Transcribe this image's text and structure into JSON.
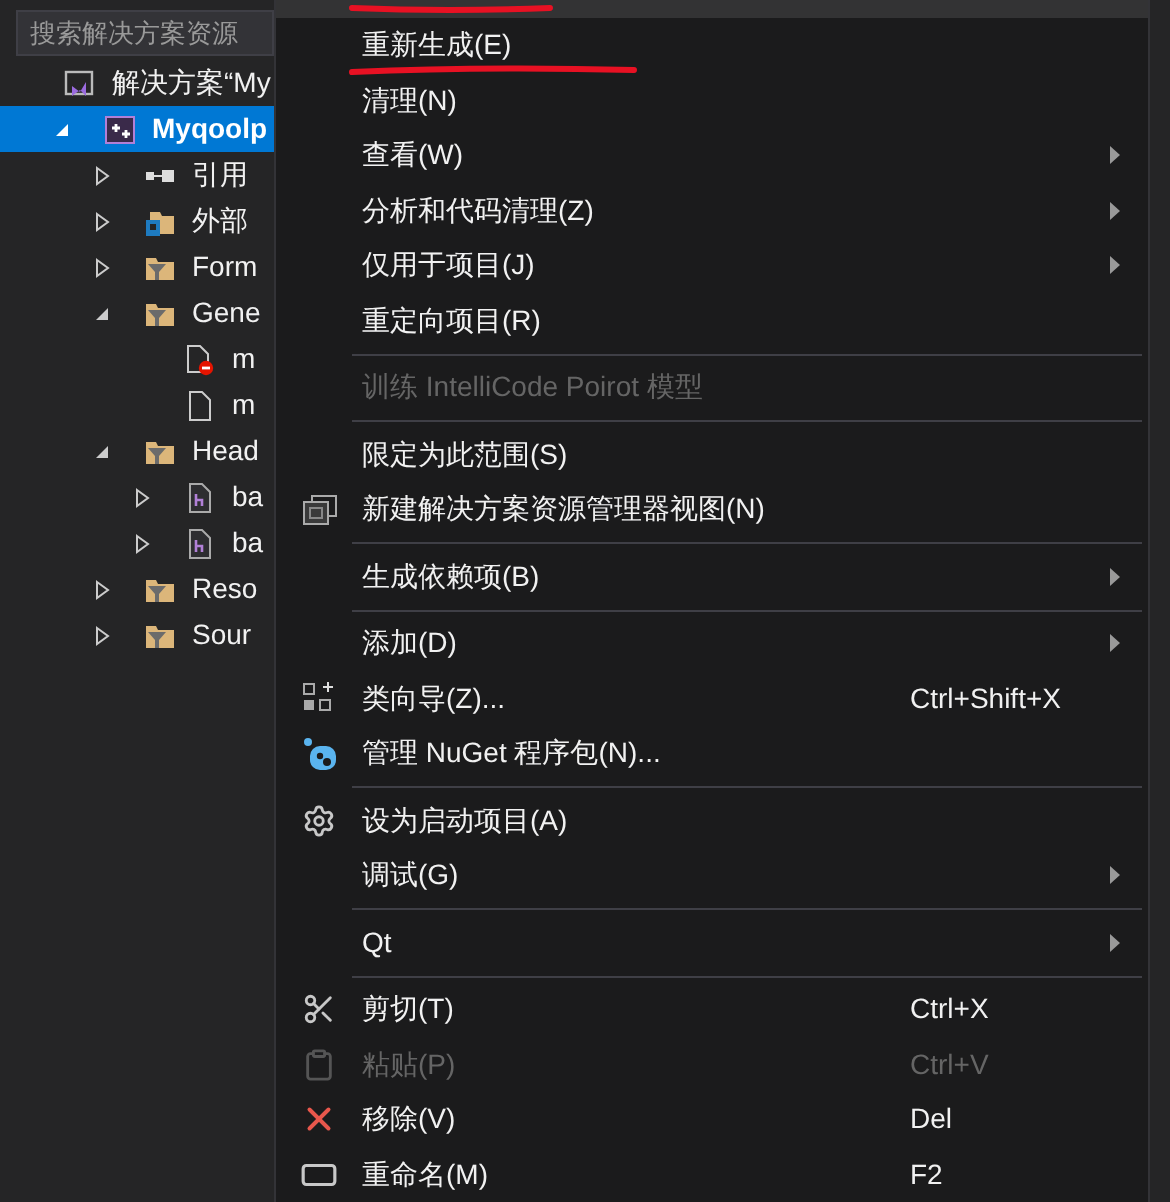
{
  "solution_explorer": {
    "search": {
      "placeholder": "搜索解决方案资源"
    },
    "tree": [
      {
        "label": "解决方案“My",
        "kind": "solution",
        "selected": false,
        "children": [
          {
            "label": "Myqoolp",
            "kind": "project",
            "selected": true,
            "expanded": true,
            "children": [
              {
                "label": "引用",
                "kind": "reference",
                "selected": false,
                "expanded": false
              },
              {
                "label": "外部",
                "kind": "external",
                "selected": false,
                "expanded": false
              },
              {
                "label": "Form",
                "kind": "filter",
                "selected": false,
                "expanded": false
              },
              {
                "label": "Gene",
                "kind": "filter",
                "selected": false,
                "expanded": true,
                "children": [
                  {
                    "label": "m",
                    "kind": "error-file",
                    "selected": false
                  },
                  {
                    "label": "m",
                    "kind": "file",
                    "selected": false
                  }
                ]
              },
              {
                "label": "Head",
                "kind": "filter",
                "selected": false,
                "expanded": true,
                "children": [
                  {
                    "label": "ba",
                    "kind": "header",
                    "selected": false,
                    "expanded": false
                  },
                  {
                    "label": "ba",
                    "kind": "header",
                    "selected": false,
                    "expanded": false
                  }
                ]
              },
              {
                "label": "Reso",
                "kind": "filter",
                "selected": false,
                "expanded": false
              },
              {
                "label": "Sour",
                "kind": "filter",
                "selected": false,
                "expanded": false
              }
            ]
          }
        ]
      }
    ]
  },
  "context_menu": {
    "items": [
      {
        "kind": "item",
        "label": "重新生成(E)",
        "disabled": false,
        "submenu": false
      },
      {
        "kind": "item",
        "label": "清理(N)",
        "disabled": false,
        "submenu": false
      },
      {
        "kind": "item",
        "label": "查看(W)",
        "disabled": false,
        "submenu": true
      },
      {
        "kind": "item",
        "label": "分析和代码清理(Z)",
        "disabled": false,
        "submenu": true
      },
      {
        "kind": "item",
        "label": "仅用于项目(J)",
        "disabled": false,
        "submenu": true
      },
      {
        "kind": "item",
        "label": "重定向项目(R)",
        "disabled": false,
        "submenu": false
      },
      {
        "kind": "separator"
      },
      {
        "kind": "item",
        "label": "训练 IntelliCode Poirot 模型",
        "disabled": true,
        "submenu": false
      },
      {
        "kind": "separator"
      },
      {
        "kind": "item",
        "label": "限定为此范围(S)",
        "disabled": false,
        "submenu": false
      },
      {
        "kind": "item",
        "label": "新建解决方案资源管理器视图(N)",
        "disabled": false,
        "submenu": false
      },
      {
        "kind": "separator"
      },
      {
        "kind": "item",
        "label": "生成依赖项(B)",
        "disabled": false,
        "submenu": true
      },
      {
        "kind": "separator"
      },
      {
        "kind": "item",
        "label": "添加(D)",
        "disabled": false,
        "submenu": true
      },
      {
        "kind": "item",
        "label": "类向导(Z)...",
        "shortcut": "Ctrl+Shift+X",
        "disabled": false,
        "submenu": false
      },
      {
        "kind": "item",
        "label": "管理 NuGet 程序包(N)...",
        "disabled": false,
        "submenu": false
      },
      {
        "kind": "separator"
      },
      {
        "kind": "item",
        "label": "设为启动项目(A)",
        "disabled": false,
        "submenu": false
      },
      {
        "kind": "item",
        "label": "调试(G)",
        "disabled": false,
        "submenu": true
      },
      {
        "kind": "separator"
      },
      {
        "kind": "item",
        "label": "Qt",
        "disabled": false,
        "submenu": true
      },
      {
        "kind": "separator"
      },
      {
        "kind": "item",
        "label": "剪切(T)",
        "shortcut": "Ctrl+X",
        "disabled": false,
        "submenu": false
      },
      {
        "kind": "item",
        "label": "粘贴(P)",
        "shortcut": "Ctrl+V",
        "disabled": true,
        "submenu": false
      },
      {
        "kind": "item",
        "label": "移除(V)",
        "shortcut": "Del",
        "disabled": false,
        "submenu": false
      },
      {
        "kind": "item",
        "label": "重命名(M)",
        "shortcut": "F2",
        "disabled": false,
        "submenu": false
      }
    ]
  }
}
